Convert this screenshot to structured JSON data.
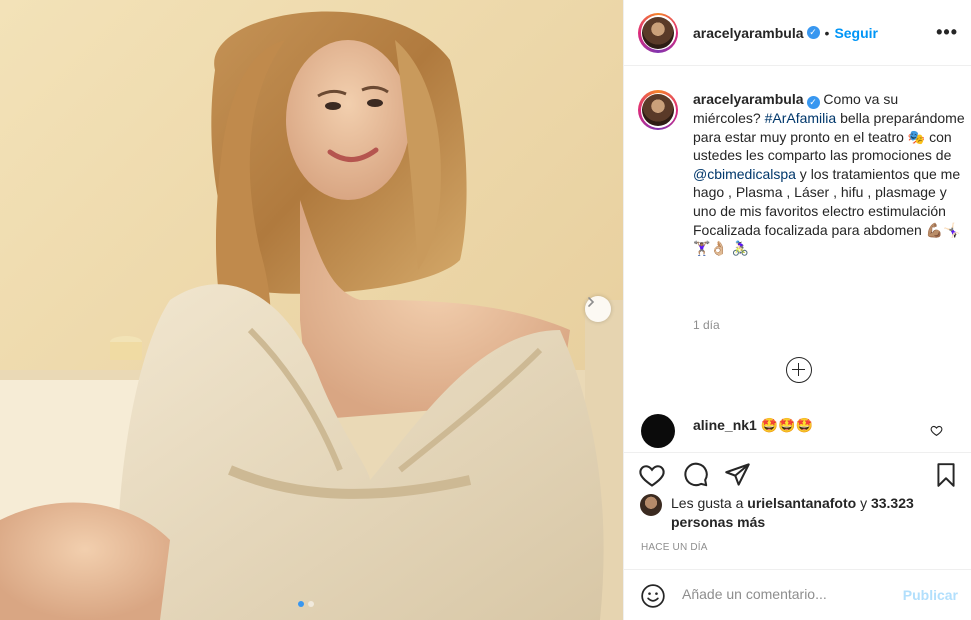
{
  "post": {
    "username": "aracelyarambula",
    "verified_icon": "verified-badge-icon",
    "separator": "•",
    "follow_label": "Seguir",
    "more_icon": "more-options-icon",
    "more_label": "•••",
    "image_description_icon": "photo-woman-in-bathrobe",
    "carousel_dots": 2,
    "carousel_active": 0
  },
  "caption": {
    "username": "aracelyarambula",
    "text_1": " Como va su miércoles? ",
    "hashtag": "#ArAfamilia",
    "text_2": " bella preparándome para estar muy pronto en el teatro 🎭 con ustedes les comparto las promociones de ",
    "mention": "@cbimedicalspa",
    "text_3": " y los tratamientos que me hago , Plasma , Láser , hifu , plasmage y uno de mis favoritos electro estimulación Focalizada focalizada para abdomen 💪🏽🤸🏻‍♀️🏋🏽‍♀️👌🏼 🚴🏻‍♀️",
    "time": "1 día"
  },
  "comments": [
    {
      "username": "aline_nk1",
      "text": "🤩🤩🤩"
    }
  ],
  "likes": {
    "prefix": "Les gusta a ",
    "user": "urielsantanafoto",
    "middle": " y ",
    "count": "33.323 personas más"
  },
  "timestamp": "HACE UN DÍA",
  "add_comment": {
    "placeholder": "Añade un comentario...",
    "publish_label": "Publicar"
  },
  "colors": {
    "accent": "#0095f6",
    "verified": "#3897f0",
    "link": "#00376b",
    "muted": "#8e8e8e",
    "publish_disabled": "#b2dffc"
  }
}
